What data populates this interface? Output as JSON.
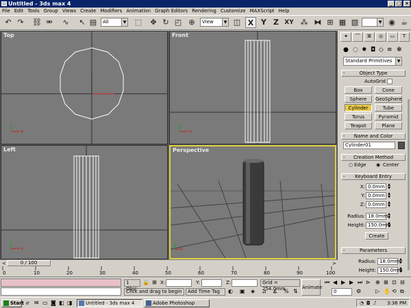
{
  "window": {
    "title": "Untitled - 3ds max 4",
    "min": "_",
    "max": "□",
    "close": "×"
  },
  "menu": [
    "File",
    "Edit",
    "Tools",
    "Group",
    "Views",
    "Create",
    "Modifiers",
    "Animation",
    "Graph Editors",
    "Rendering",
    "Customize",
    "MAXScript",
    "Help"
  ],
  "toolbar": {
    "selection_filter": "All",
    "ref_coord": "View",
    "axis_x": "X",
    "axis_y": "Y",
    "axis_z": "Z",
    "axis_xy": "XY"
  },
  "viewports": {
    "top": "Top",
    "front": "Front",
    "left": "Left",
    "perspective": "Perspective"
  },
  "command_panel": {
    "category": "Standard Primitives",
    "object_type": {
      "header": "Object Type",
      "autogrid": "AutoGrid",
      "buttons": [
        "Box",
        "Cone",
        "Sphere",
        "GeoSphere",
        "Cylinder",
        "Tube",
        "Torus",
        "Pyramid",
        "Teapot",
        "Plane"
      ],
      "active": "Cylinder"
    },
    "name_color": {
      "header": "Name and Color",
      "name": "Cylinder01",
      "swatch": "#505050"
    },
    "creation_method": {
      "header": "Creation Method",
      "edge": "Edge",
      "center": "Center"
    },
    "keyboard_entry": {
      "header": "Keyboard Entry",
      "x_label": "X:",
      "x": "0.0mm",
      "y_label": "Y:",
      "y": "0.0mm",
      "z_label": "Z:",
      "z": "0.0mm",
      "radius_label": "Radius:",
      "radius": "18.0mm",
      "height_label": "Height:",
      "height": "150.0mm",
      "create": "Create"
    },
    "parameters": {
      "header": "Parameters",
      "radius_label": "Radius:",
      "radius": "18.0mm",
      "height_label": "Height:",
      "height": "150.0mm"
    }
  },
  "timeline": {
    "frame": "0 / 100",
    "ticks": [
      "0",
      "10",
      "20",
      "30",
      "40",
      "50",
      "60",
      "70",
      "80",
      "90",
      "100"
    ]
  },
  "status": {
    "selection": "1 Obje",
    "x_label": "X:",
    "y_label": "Y:",
    "z_label": "Z:",
    "grid": "Grid = 254.0mm",
    "animate": "Animate",
    "prompt": "Click and drag to begin creatio",
    "add_time_tag": "Add Time Tag",
    "frame_field": "0"
  },
  "taskbar": {
    "start": "Start",
    "tasks": [
      "Untitled - 3ds max 4",
      "Adobe Photoshop"
    ],
    "clock": "3:36 PM"
  },
  "colors": {
    "accent_yellow": "#e8c84a",
    "viewport_bg": "#7a7a7a",
    "title_blue": "#0a246a",
    "active_border": "#e0d040",
    "status_pink": "#e8c0c8"
  }
}
